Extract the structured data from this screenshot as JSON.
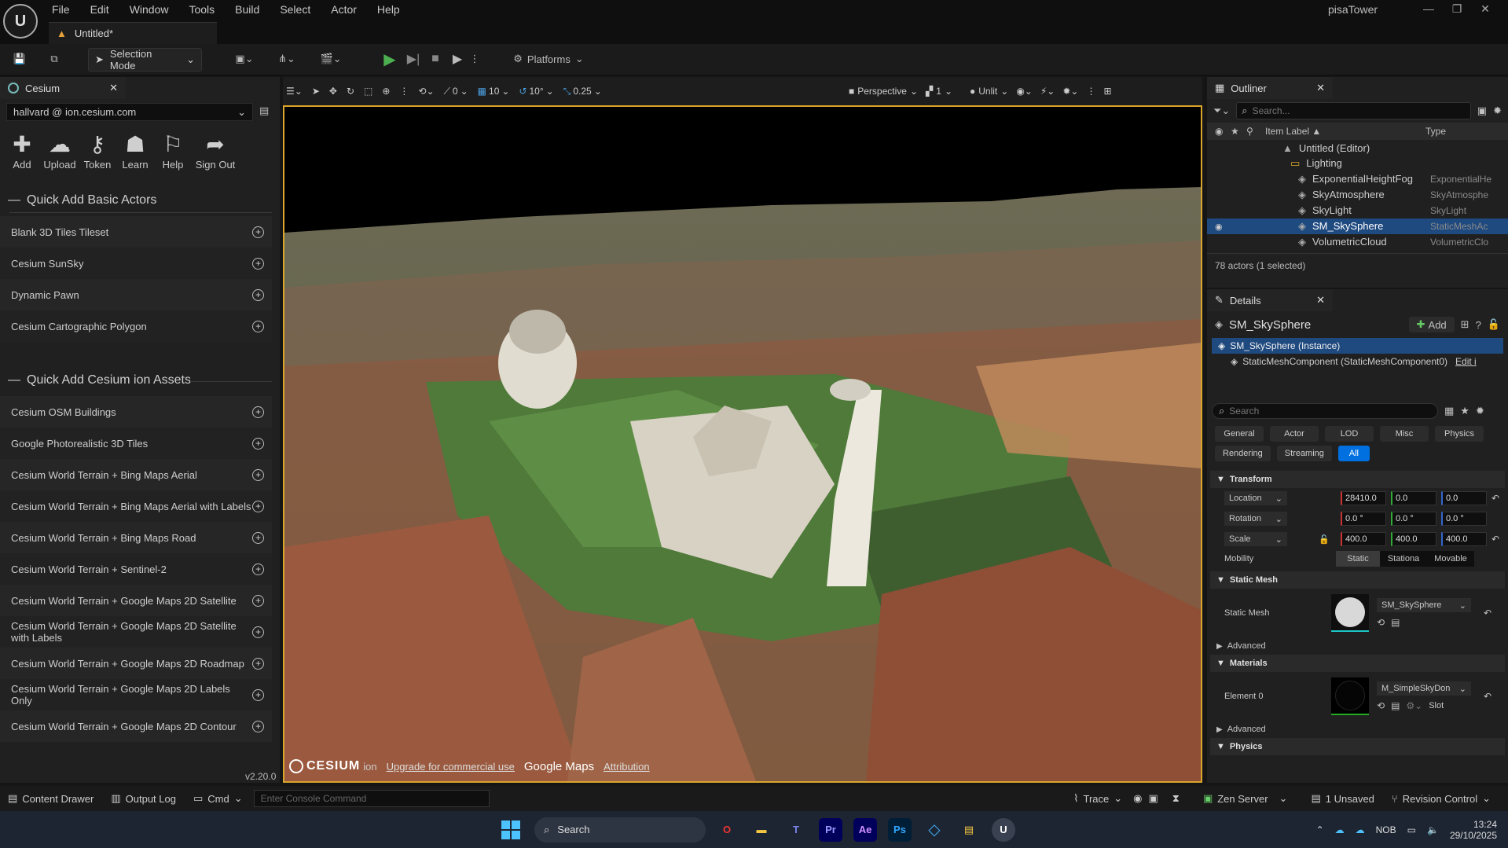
{
  "menu": [
    "File",
    "Edit",
    "Window",
    "Tools",
    "Build",
    "Select",
    "Actor",
    "Help"
  ],
  "doc_tab": "Untitled*",
  "app_name": "pisaTower",
  "toolbar": {
    "selection_mode": "Selection Mode",
    "platforms": "Platforms"
  },
  "cesium": {
    "tab": "Cesium",
    "account": "hallvard @ ion.cesium.com",
    "buttons": [
      "Add",
      "Upload",
      "Token",
      "Learn",
      "Help",
      "Sign Out"
    ],
    "section_basic": "Quick Add Basic Actors",
    "basic_items": [
      "Blank 3D Tiles Tileset",
      "Cesium SunSky",
      "Dynamic Pawn",
      "Cesium Cartographic Polygon"
    ],
    "section_ion": "Quick Add Cesium ion Assets",
    "ion_items": [
      "Cesium OSM Buildings",
      "Google Photorealistic 3D Tiles",
      "Cesium World Terrain + Bing Maps Aerial",
      "Cesium World Terrain + Bing Maps Aerial with Labels",
      "Cesium World Terrain + Bing Maps Road",
      "Cesium World Terrain + Sentinel-2",
      "Cesium World Terrain + Google Maps 2D Satellite",
      "Cesium World Terrain + Google Maps 2D Satellite with Labels",
      "Cesium World Terrain + Google Maps 2D Roadmap",
      "Cesium World Terrain + Google Maps 2D Labels Only",
      "Cesium World Terrain + Google Maps 2D Contour"
    ],
    "version": "v2.20.0"
  },
  "viewport": {
    "snap_translate": "10",
    "snap_rotate": "10°",
    "snap_scale": "0.25",
    "zero": "0",
    "view_mode_perspective": "Perspective",
    "lit_mode": "Unlit",
    "camera_speed": "1",
    "credits": {
      "brand": "CESIUM",
      "ion": "ion",
      "upgrade": "Upgrade for commercial use",
      "google": "Google Maps",
      "attribution": "Attribution"
    }
  },
  "outliner": {
    "tab": "Outliner",
    "search_placeholder": "Search...",
    "col_label": "Item Label ▲",
    "col_type": "Type",
    "rows": [
      {
        "label": "Untitled (Editor)",
        "type": ""
      },
      {
        "label": "Lighting",
        "type": ""
      },
      {
        "label": "ExponentialHeightFog",
        "type": "ExponentialHe"
      },
      {
        "label": "SkyAtmosphere",
        "type": "SkyAtmosphe"
      },
      {
        "label": "SkyLight",
        "type": "SkyLight"
      },
      {
        "label": "SM_SkySphere",
        "type": "StaticMeshAc"
      },
      {
        "label": "VolumetricCloud",
        "type": "VolumetricClo"
      }
    ],
    "count": "78 actors (1 selected)"
  },
  "details": {
    "tab": "Details",
    "actor_name": "SM_SkySphere",
    "add_label": "Add",
    "instance": "SM_SkySphere (Instance)",
    "component": "StaticMeshComponent (StaticMeshComponent0)",
    "edit_link": "Edit i",
    "search_placeholder": "Search",
    "filters_row1": [
      "General",
      "Actor",
      "LOD",
      "Misc",
      "Physics"
    ],
    "filters_row2": [
      "Rendering",
      "Streaming",
      "All"
    ],
    "transform": "Transform",
    "location": {
      "label": "Location",
      "x": "28410.0",
      "y": "0.0",
      "z": "0.0"
    },
    "rotation": {
      "label": "Rotation",
      "x": "0.0 °",
      "y": "0.0 °",
      "z": "0.0 °"
    },
    "scale": {
      "label": "Scale",
      "x": "400.0",
      "y": "400.0",
      "z": "400.0"
    },
    "mobility": {
      "label": "Mobility",
      "options": [
        "Static",
        "Stationa",
        "Movable"
      ]
    },
    "static_mesh_section": "Static Mesh",
    "static_mesh_label": "Static Mesh",
    "static_mesh_value": "SM_SkySphere",
    "advanced": "Advanced",
    "materials_section": "Materials",
    "element0": "Element 0",
    "material_value": "M_SimpleSkyDon",
    "slot": "Slot",
    "physics_section": "Physics"
  },
  "status": {
    "content_drawer": "Content Drawer",
    "output_log": "Output Log",
    "cmd": "Cmd",
    "console_placeholder": "Enter Console Command",
    "trace": "Trace",
    "zen_server": "Zen Server",
    "unsaved": "1 Unsaved",
    "revision_control": "Revision Control"
  },
  "taskbar": {
    "search": "Search",
    "apps": [
      "O",
      "▬",
      "T",
      "Pr",
      "Ae",
      "Ps",
      "◇",
      "▤",
      "U"
    ],
    "lang": "NOB",
    "time": "13:24",
    "date": "29/10/2025"
  },
  "colors": {
    "accent": "#d9a52b",
    "selected": "#1f4a80",
    "play": "#4caf50"
  }
}
